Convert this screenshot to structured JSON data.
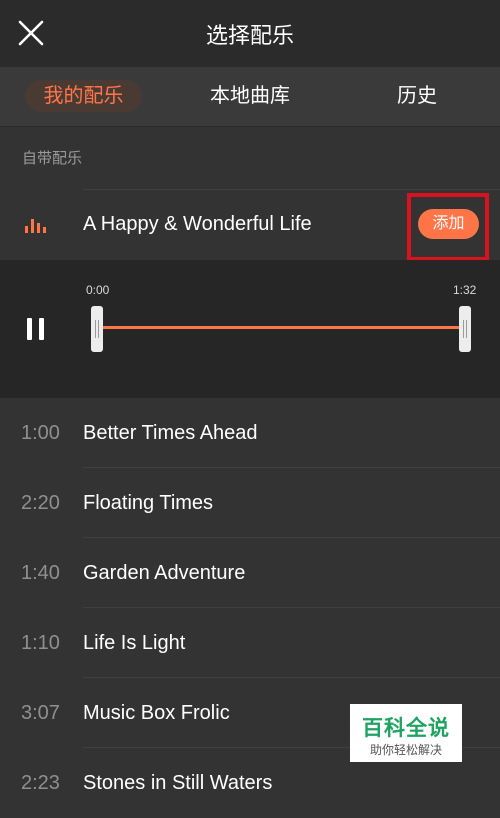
{
  "header": {
    "title": "选择配乐",
    "close_icon": "close-icon"
  },
  "tabs": [
    {
      "label": "我的配乐",
      "active": true
    },
    {
      "label": "本地曲库",
      "active": false
    },
    {
      "label": "历史",
      "active": false
    }
  ],
  "section": {
    "label": "自带配乐"
  },
  "now_playing": {
    "name": "A Happy & Wonderful Life",
    "add_label": "添加",
    "icon": "equalizer-icon",
    "start_time": "0:00",
    "end_time": "1:32",
    "pause_icon": "pause-icon"
  },
  "tracks": [
    {
      "duration": "1:00",
      "name": "Better Times Ahead"
    },
    {
      "duration": "2:20",
      "name": "Floating Times"
    },
    {
      "duration": "1:40",
      "name": "Garden Adventure"
    },
    {
      "duration": "1:10",
      "name": "Life Is Light"
    },
    {
      "duration": "3:07",
      "name": "Music Box Frolic"
    },
    {
      "duration": "2:23",
      "name": "Stones in Still Waters"
    }
  ],
  "watermark": {
    "main": "百科全说",
    "sub": "助你轻松解决"
  },
  "colors": {
    "accent": "#ff7548",
    "highlight_box": "#d8131f",
    "background": "#333333",
    "player_background": "#262626",
    "watermark_green": "#1ea362"
  }
}
